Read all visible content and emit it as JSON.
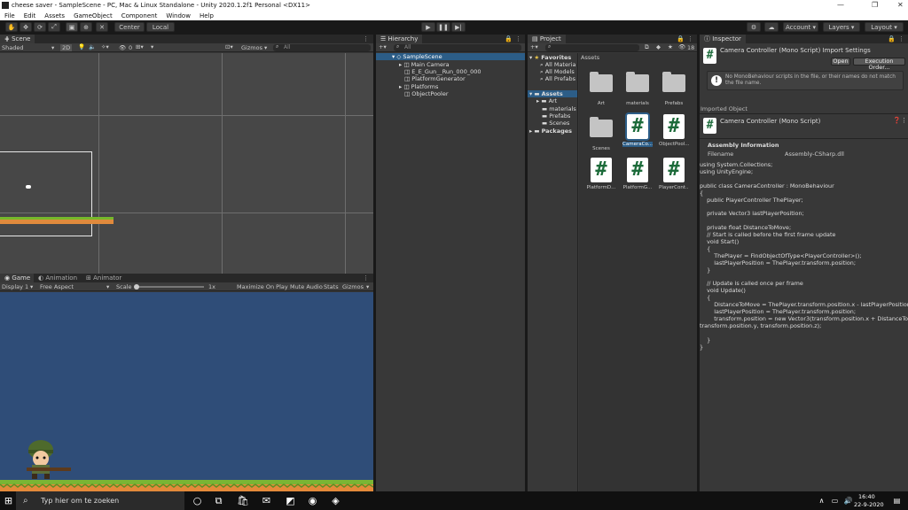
{
  "window": {
    "title": "cheese saver - SampleScene - PC, Mac & Linux Standalone - Unity 2020.1.2f1 Personal <DX11>"
  },
  "menu": [
    "File",
    "Edit",
    "Assets",
    "GameObject",
    "Component",
    "Window",
    "Help"
  ],
  "toolbar": {
    "center_label": "Center",
    "local_label": "Local",
    "account_label": "Account",
    "layers_label": "Layers",
    "layout_label": "Layout"
  },
  "scene": {
    "tab_label": "Scene",
    "shading": "Shaded",
    "mode_2d": "2D",
    "gizmo_count": "0",
    "gizmos_label": "Gizmos",
    "search_placeholder": "All"
  },
  "game": {
    "tabs": [
      "Game",
      "Animation",
      "Animator"
    ],
    "display": "Display 1",
    "aspect": "Free Aspect",
    "scale_label": "Scale",
    "scale_value": "1x",
    "maximize": "Maximize On Play",
    "mute": "Mute Audio",
    "stats": "Stats",
    "gizmos": "Gizmos"
  },
  "hierarchy": {
    "tab_label": "Hierarchy",
    "search_placeholder": "All",
    "scene": "SampleScene",
    "items": [
      "Main Camera",
      "E_E_Gun__Run_000_000",
      "PlatformGenerator",
      "Platforms",
      "ObjectPooler"
    ]
  },
  "project": {
    "tab_label": "Project",
    "hidden_count": "18",
    "favorites": "Favorites",
    "favorite_items": [
      "All Materia",
      "All Models",
      "All Prefabs"
    ],
    "assets_root": "Assets",
    "asset_folders": [
      "Art",
      "materials",
      "Prefabs",
      "Scenes"
    ],
    "packages": "Packages",
    "breadcrumb": "Assets",
    "grid": [
      {
        "name": "Art",
        "kind": "folder"
      },
      {
        "name": "materials",
        "kind": "folder"
      },
      {
        "name": "Prefabs",
        "kind": "folder"
      },
      {
        "name": "Scenes",
        "kind": "folder"
      },
      {
        "name": "CameraCo...",
        "kind": "script"
      },
      {
        "name": "ObjectPool...",
        "kind": "script"
      },
      {
        "name": "PlatformD...",
        "kind": "script"
      },
      {
        "name": "PlatformG...",
        "kind": "script"
      },
      {
        "name": "PlayerCont...",
        "kind": "script"
      }
    ]
  },
  "inspector": {
    "tab_label": "Inspector",
    "header_title": "Camera Controller (Mono Script) Import Settings",
    "open_label": "Open",
    "exec_order_label": "Execution Order...",
    "warning": "No MonoBehaviour scripts in the file, or their names do not match the file name.",
    "imported_object_label": "Imported Object",
    "object_title": "Camera Controller (Mono Script)",
    "assembly_info_label": "Assembly Information",
    "filename_label": "Filename",
    "filename_value": "Assembly-CSharp.dll",
    "code": "using System.Collections;\nusing UnityEngine;\n\npublic class CameraController : MonoBehaviour\n{\n    public PlayerController ThePlayer;\n\n    private Vector3 lastPlayerPosition;\n\n    private float DistanceToMove;\n    // Start is called before the first frame update\n    void Start()\n    {\n        ThePlayer = FindObjectOfType<PlayerController>();\n        lastPlayerPosition = ThePlayer.transform.position;\n    }\n\n    // Update is called once per frame\n    void Update()\n    {\n        DistanceToMove = ThePlayer.transform.position.x - lastPlayerPosition.x;\n        lastPlayerPosition = ThePlayer.transform.position;\n        transform.position = new Vector3(transform.position.x + DistanceToMove,\ntransform.position.y, transform.position.z);\n\n    }\n}"
  },
  "taskbar": {
    "search_placeholder": "Typ hier om te zoeken",
    "time": "16:40",
    "date": "22-9-2020"
  }
}
